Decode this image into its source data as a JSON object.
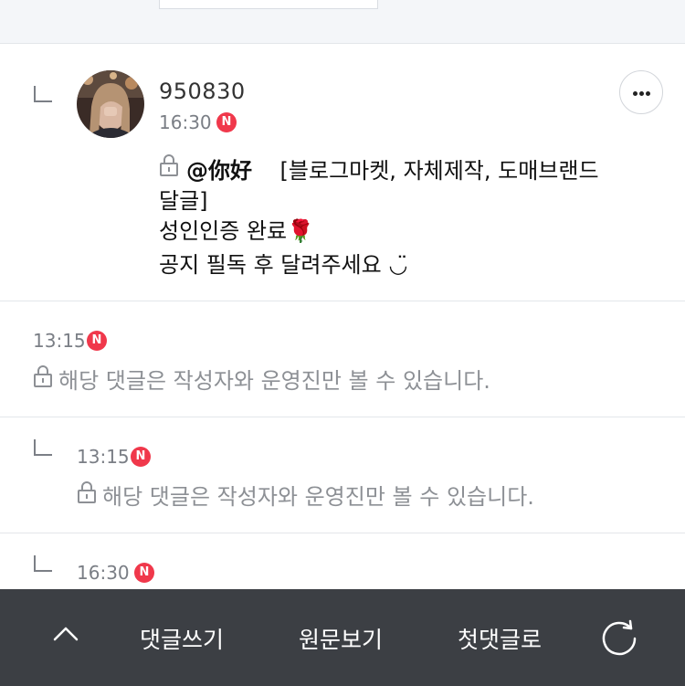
{
  "comment": {
    "nickname": "950830",
    "time": "16:30",
    "new_badge": "N",
    "mention": "@你好",
    "text_line1": "[블로그마켓, 자체제작, 도매브랜드",
    "text_line2": "달글]",
    "text_line3": "성인인증 완료",
    "text_line4": "공지 필독 후 달려주세요",
    "rose_emoji": "🌹",
    "smile_emoji": "◡̈"
  },
  "secret_comments": [
    {
      "time": "13:15",
      "badge": "N",
      "message": "해당 댓글은 작성자와 운영진만 볼 수 있습니다."
    },
    {
      "time": "13:15",
      "badge": "N",
      "message": "해당 댓글은 작성자와 운영진만 볼 수 있습니다."
    },
    {
      "time": "16:30",
      "badge": "N"
    }
  ],
  "bottom_bar": {
    "write_comment": "댓글쓰기",
    "view_original": "원문보기",
    "first_comment": "첫댓글로"
  },
  "icons": {
    "up": "chevron-up-icon",
    "refresh": "refresh-icon",
    "more": "more-icon",
    "lock": "lock-icon"
  },
  "colors": {
    "badge": "#f0384b",
    "bottom_bar": "#3c3f44"
  }
}
